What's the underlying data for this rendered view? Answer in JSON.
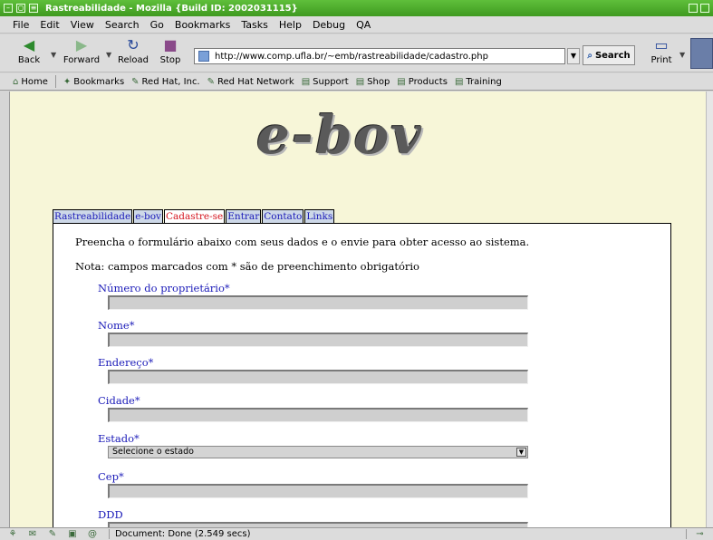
{
  "window": {
    "title": "Rastreabilidade - Mozilla {Build ID: 2002031115}"
  },
  "menu": [
    "File",
    "Edit",
    "View",
    "Search",
    "Go",
    "Bookmarks",
    "Tasks",
    "Help",
    "Debug",
    "QA"
  ],
  "nav": {
    "back": "Back",
    "forward": "Forward",
    "reload": "Reload",
    "stop": "Stop",
    "url": "http://www.comp.ufla.br/~emb/rastreabilidade/cadastro.php",
    "search": "Search",
    "print": "Print"
  },
  "personal_toolbar": [
    "Home",
    "Bookmarks",
    "Red Hat, Inc.",
    "Red Hat Network",
    "Support",
    "Shop",
    "Products",
    "Training"
  ],
  "page": {
    "logo": "e-bov",
    "tabs": [
      {
        "label": "Rastreabilidade",
        "active": false
      },
      {
        "label": "e-bov",
        "active": false
      },
      {
        "label": "Cadastre-se",
        "active": true
      },
      {
        "label": "Entrar",
        "active": false
      },
      {
        "label": "Contato",
        "active": false
      },
      {
        "label": "Links",
        "active": false
      }
    ],
    "intro": "Preencha o formulário abaixo com seus dados e o envie para obter acesso ao sistema.",
    "nota": "Nota: campos marcados com * são de preenchimento obrigatório",
    "fields": [
      {
        "label": "Número do proprietário*",
        "value": ""
      },
      {
        "label": "Nome*",
        "value": ""
      },
      {
        "label": "Endereço*",
        "value": ""
      },
      {
        "label": "Cidade*",
        "value": ""
      },
      {
        "label": "Estado*",
        "value": "Selecione o estado"
      },
      {
        "label": "Cep*",
        "value": ""
      },
      {
        "label": "DDD",
        "value": ""
      }
    ]
  },
  "status": {
    "message": "Document: Done (2.549 secs)"
  },
  "colors": {
    "titlebar": "#4fae2c",
    "content_bg": "#f7f6d8",
    "tab_bg": "#cdd8e8",
    "tab_link": "#1a1ab8",
    "tab_active": "#d4141e"
  }
}
